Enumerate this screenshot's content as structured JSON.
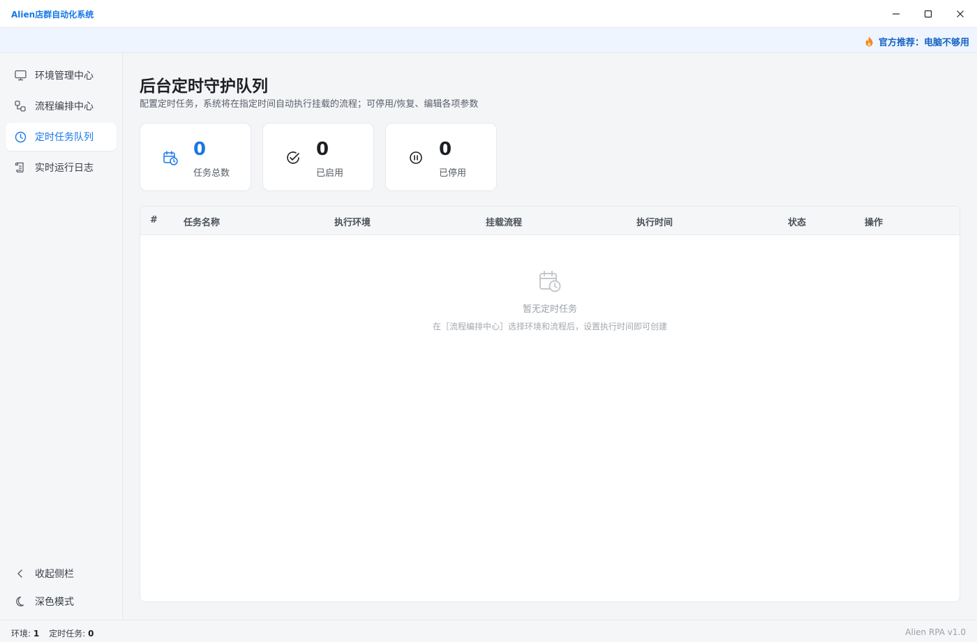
{
  "window": {
    "title": "Alien店群自动化系统",
    "controls": [
      "minimize",
      "maximize",
      "close"
    ]
  },
  "notice": {
    "icon": "fire-icon",
    "text": "官方推荐：电脑不够用"
  },
  "sidebar": {
    "items": [
      {
        "label": "环境管理中心",
        "icon": "monitor-icon",
        "active": false
      },
      {
        "label": "流程编排中心",
        "icon": "workflow-icon",
        "active": false
      },
      {
        "label": "定时任务队列",
        "icon": "clock-icon",
        "active": true
      },
      {
        "label": "实时运行日志",
        "icon": "scroll-icon",
        "active": false
      }
    ],
    "collapse_label": "收起侧栏",
    "dark_mode_label": "深色模式"
  },
  "main": {
    "title": "后台定时守护队列",
    "description": "配置定时任务，系统将在指定时间自动执行挂载的流程；可停用/恢复、编辑各项参数",
    "stats": [
      {
        "value": "0",
        "label": "任务总数",
        "icon": "calendar-clock-icon"
      },
      {
        "value": "0",
        "label": "已启用",
        "icon": "check-circle-icon"
      },
      {
        "value": "0",
        "label": "已停用",
        "icon": "pause-circle-icon"
      }
    ],
    "table": {
      "columns": [
        "#",
        "任务名称",
        "执行环境",
        "挂载流程",
        "执行时间",
        "状态",
        "操作"
      ],
      "rows": [],
      "empty_title": "暂无定时任务",
      "empty_desc": "在［流程编排中心］选择环境和流程后，设置执行时间即可创建"
    }
  },
  "statusbar": {
    "env_label": "环境:",
    "env_value": "1",
    "tasks_label": "定时任务:",
    "tasks_value": "0",
    "version": "Alien RPA v1.0"
  },
  "colors": {
    "accent": "#1677e6",
    "notice_bg": "#eef5ff",
    "fire": "#f08a24"
  }
}
